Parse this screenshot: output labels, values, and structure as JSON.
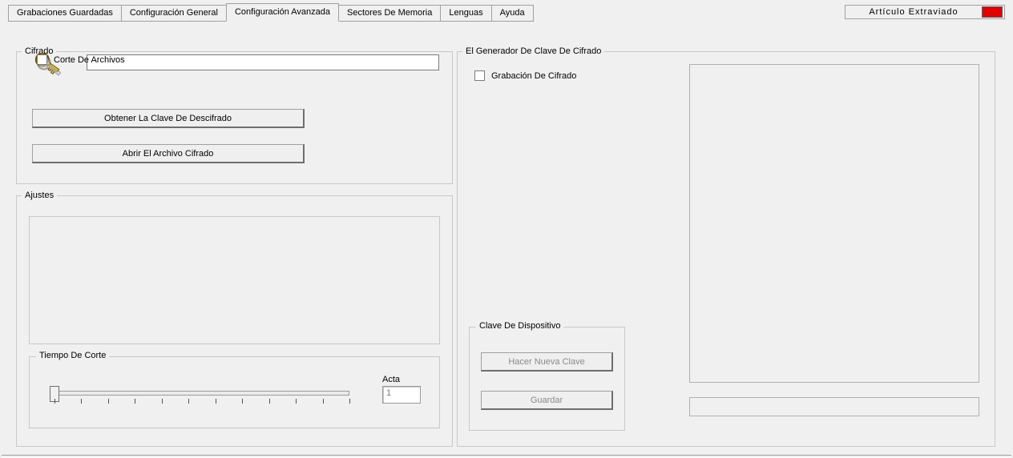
{
  "tabs": {
    "t0": "Grabaciones Guardadas",
    "t1": "Configuración General",
    "t2": "Configuración Avanzada",
    "t3": "Sectores De Memoria",
    "t4": "Lenguas",
    "t5": "Ayuda"
  },
  "status": {
    "label": "Artículo   Extraviado",
    "led_color": "#e00000"
  },
  "encryption": {
    "legend": "Cifrado",
    "key_value": "",
    "get_key_btn": "Obtener La Clave De Descifrado",
    "open_file_btn": "Abrir El Archivo Cifrado"
  },
  "settings": {
    "legend": "Ajustes",
    "file_cut_label": "Corte De Archivos",
    "file_cut_checked": false
  },
  "cut_time": {
    "legend": "Tiempo De Corte",
    "acta_label": "Acta",
    "acta_value": "1",
    "slider_value": 0
  },
  "generator": {
    "legend": "El Generador De Clave De Cifrado",
    "record_label": "Grabación De Cifrado",
    "record_checked": false,
    "device_key_legend": "Clave De Dispositivo",
    "new_key_btn": "Hacer Nueva Clave",
    "save_btn": "Guardar"
  }
}
